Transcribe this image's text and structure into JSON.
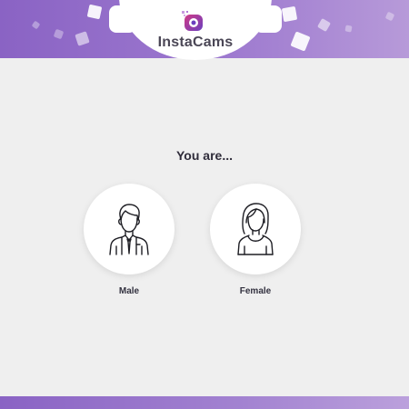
{
  "brand": {
    "name": "InstaCams",
    "logo_icon": "webcam-logo-icon",
    "accent_color": "#8a63c4",
    "logo_gradient": [
      "#c43a8c",
      "#6b3fbf"
    ]
  },
  "main": {
    "question": "You are...",
    "options": [
      {
        "label": "Male",
        "icon": "male-avatar-icon"
      },
      {
        "label": "Female",
        "icon": "female-avatar-icon"
      }
    ]
  }
}
